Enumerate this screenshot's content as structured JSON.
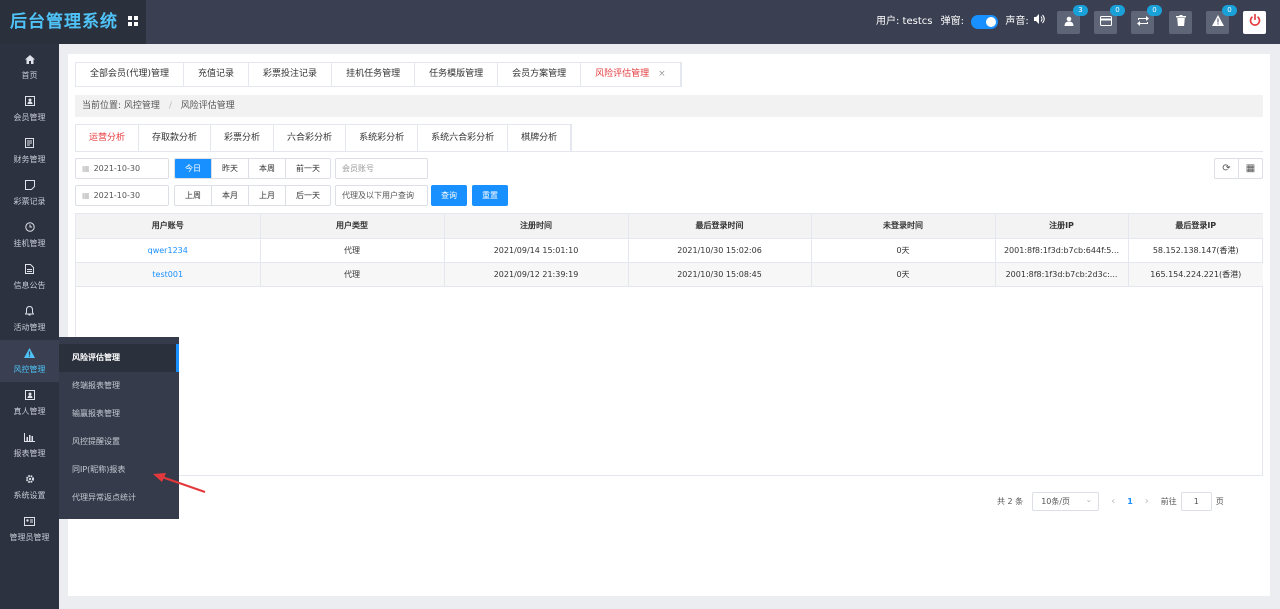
{
  "app": {
    "title": "后台管理系统"
  },
  "header": {
    "user_label": "用户: testcs",
    "popup_label": "弹窗:",
    "sound_label": "声音:",
    "buttons": [
      {
        "name": "user-icon",
        "badge": "3"
      },
      {
        "name": "card-icon",
        "badge": "0"
      },
      {
        "name": "transfer-icon",
        "badge": "0"
      },
      {
        "name": "trash-icon",
        "badge": ""
      },
      {
        "name": "warning-icon",
        "badge": "0"
      }
    ]
  },
  "sidebar": {
    "items": [
      {
        "label": "首页",
        "icon": "home-icon"
      },
      {
        "label": "会员管理",
        "icon": "member-icon"
      },
      {
        "label": "财务管理",
        "icon": "finance-icon"
      },
      {
        "label": "彩票记录",
        "icon": "lottery-icon"
      },
      {
        "label": "挂机管理",
        "icon": "hangup-icon"
      },
      {
        "label": "信息公告",
        "icon": "notice-icon"
      },
      {
        "label": "活动管理",
        "icon": "bell-icon"
      },
      {
        "label": "风控管理",
        "icon": "warning-icon"
      },
      {
        "label": "真人管理",
        "icon": "live-icon"
      },
      {
        "label": "报表管理",
        "icon": "chart-icon"
      },
      {
        "label": "系统设置",
        "icon": "gear-icon"
      },
      {
        "label": "管理员管理",
        "icon": "admin-icon"
      }
    ],
    "active_index": 7
  },
  "flyout": {
    "items": [
      "风险评估管理",
      "终端报表管理",
      "输赢报表管理",
      "风控提醒设置",
      "同IP(昵称)报表",
      "代理异常返点统计"
    ],
    "active_index": 0
  },
  "tabs": {
    "items": [
      "全部会员(代理)管理",
      "充值记录",
      "彩票投注记录",
      "挂机任务管理",
      "任务模版管理",
      "会员方案管理",
      "风险评估管理"
    ],
    "active_index": 6,
    "close_symbol": "×"
  },
  "breadcrumb": {
    "prefix": "当前位置:",
    "level1": "风控管理",
    "separator": "/",
    "level2": "风险评估管理"
  },
  "subtabs": {
    "items": [
      "运营分析",
      "存取款分析",
      "彩票分析",
      "六合彩分析",
      "系统彩分析",
      "系统六合彩分析",
      "棋牌分析"
    ],
    "active_index": 0
  },
  "filters": {
    "date_start": "2021-10-30",
    "date_end": "2021-10-30",
    "range_row1": [
      "今日",
      "昨天",
      "本周",
      "前一天"
    ],
    "range_row1_active": 0,
    "range_row2": [
      "上周",
      "本月",
      "上月",
      "后一天"
    ],
    "member_placeholder": "会员账号",
    "agent_query_label": "代理及以下用户查询",
    "query_button": "查询",
    "reset_button": "重置"
  },
  "table": {
    "columns": [
      "用户账号",
      "用户类型",
      "注册时间",
      "最后登录时间",
      "未登录时间",
      "注册IP",
      "最后登录IP"
    ],
    "rows": [
      [
        "qwer1234",
        "代理",
        "2021/09/14 15:01:10",
        "2021/10/30 15:02:06",
        "0天",
        "2001:8f8:1f3d:b7cb:644f:5...",
        "58.152.138.147(香港)"
      ],
      [
        "test001",
        "代理",
        "2021/09/12 21:39:19",
        "2021/10/30 15:08:45",
        "0天",
        "2001:8f8:1f3d:b7cb:2d3c:...",
        "165.154.224.221(香港)"
      ]
    ]
  },
  "pagination": {
    "total": "共 2 条",
    "page_size": "10条/页",
    "prev": "‹",
    "current_page": "1",
    "next": "›",
    "goto_label": "前往",
    "goto_value": "1",
    "page_suffix": "页"
  },
  "colors": {
    "accent": "#1890ff",
    "active_tab": "#e4393c",
    "brand": "#4fc3f7",
    "header_bg": "#3a4052",
    "sidebar_bg": "#2d3240",
    "annotation_arrow": "#e4393c"
  }
}
